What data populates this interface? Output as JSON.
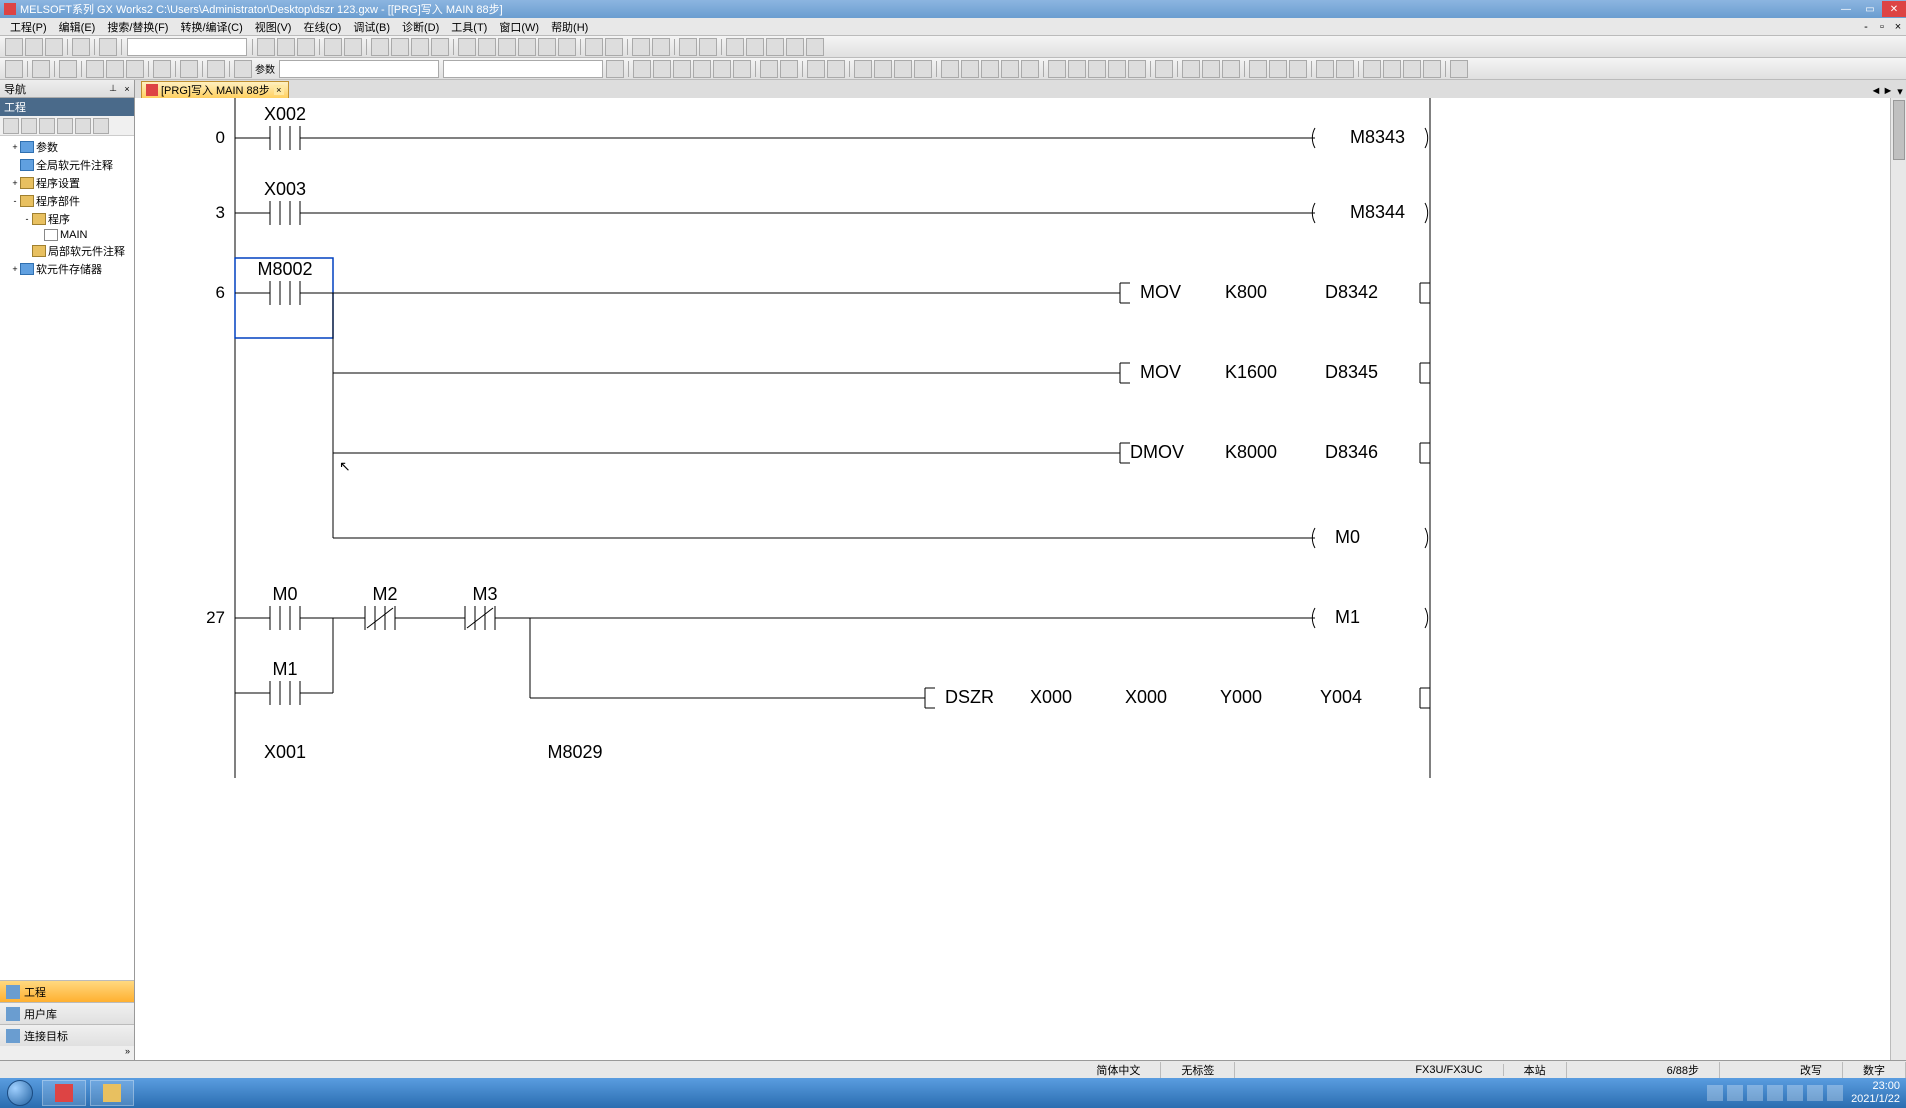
{
  "title": "MELSOFT系列 GX Works2 C:\\Users\\Administrator\\Desktop\\dszr 123.gxw - [[PRG]写入 MAIN 88步]",
  "menu": [
    "工程(P)",
    "编辑(E)",
    "搜索/替换(F)",
    "转换/编译(C)",
    "视图(V)",
    "在线(O)",
    "调试(B)",
    "诊断(D)",
    "工具(T)",
    "窗口(W)",
    "帮助(H)"
  ],
  "toolbar2": {
    "combo_label": "参数"
  },
  "nav": {
    "title": "导航",
    "header2": "工程",
    "tree": {
      "n1": "参数",
      "n2": "全局软元件注释",
      "n3": "程序设置",
      "n4": "程序部件",
      "n5": "程序",
      "n6": "MAIN",
      "n7": "局部软元件注释",
      "n8": "软元件存储器"
    },
    "bottom": {
      "b1": "工程",
      "b2": "用户库",
      "b3": "连接目标"
    }
  },
  "tab": {
    "label": "[PRG]写入 MAIN 88步"
  },
  "ladder": {
    "r0": {
      "step": "0",
      "contact": "X002",
      "coil": "M8343"
    },
    "r1": {
      "step": "3",
      "contact": "X003",
      "coil": "M8344"
    },
    "r2": {
      "step": "6",
      "contact": "M8002",
      "f1": {
        "op": "MOV",
        "s": "K800",
        "d": "D8342"
      },
      "f2": {
        "op": "MOV",
        "s": "K1600",
        "d": "D8345"
      },
      "f3": {
        "op": "DMOV",
        "s": "K8000",
        "d": "D8346"
      },
      "coil": "M0"
    },
    "r3": {
      "step": "27",
      "c1": "M0",
      "c2": "M2",
      "c3": "M3",
      "coil": "M1",
      "p1": "M1",
      "f1": {
        "op": "DSZR",
        "a": "X000",
        "b": "X000",
        "c": "Y000",
        "d": "Y004"
      },
      "p2": "X001",
      "p3": "M8029"
    }
  },
  "status": {
    "lang": "简体中文",
    "tag": "无标签",
    "plc": "FX3U/FX3UC",
    "station": "本站",
    "steps": "6/88步",
    "mode": "改写",
    "num": "数字"
  },
  "tray": {
    "time": "23:00",
    "date": "2021/1/22"
  }
}
